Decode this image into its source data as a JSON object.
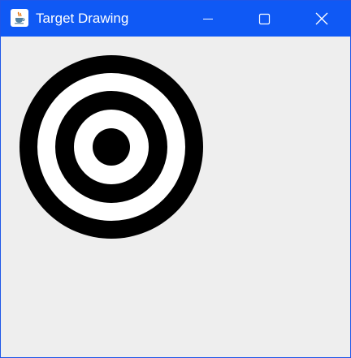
{
  "window": {
    "title": "Target Drawing",
    "title_bar_color": "#0f59f5",
    "background_color": "#eeeeee",
    "icons": {
      "app": "java-coffee-cup-icon",
      "minimize": "minimize-icon",
      "maximize": "maximize-icon",
      "close": "close-icon"
    }
  },
  "target": {
    "ring_colors": [
      "#000000",
      "#ffffff",
      "#000000",
      "#ffffff",
      "#000000"
    ]
  }
}
